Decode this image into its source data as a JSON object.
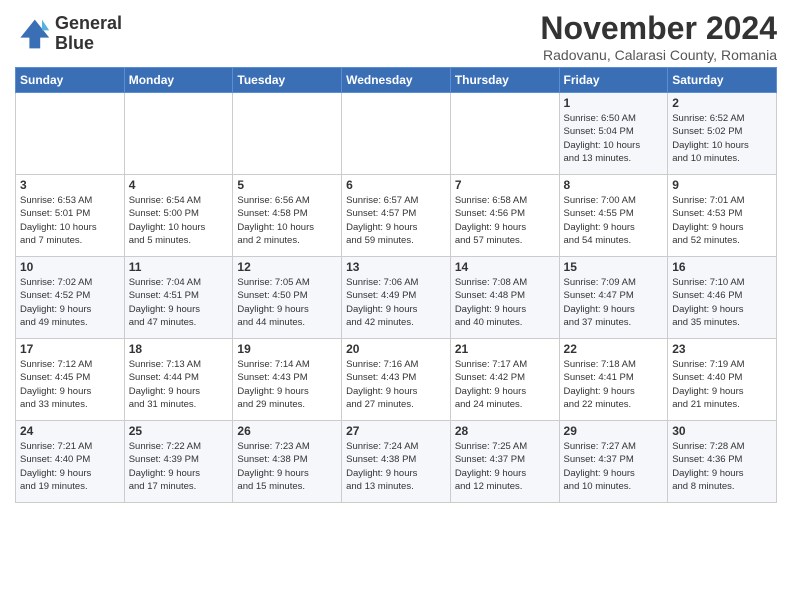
{
  "header": {
    "logo_line1": "General",
    "logo_line2": "Blue",
    "month_title": "November 2024",
    "subtitle": "Radovanu, Calarasi County, Romania"
  },
  "weekdays": [
    "Sunday",
    "Monday",
    "Tuesday",
    "Wednesday",
    "Thursday",
    "Friday",
    "Saturday"
  ],
  "weeks": [
    [
      {
        "day": "",
        "info": ""
      },
      {
        "day": "",
        "info": ""
      },
      {
        "day": "",
        "info": ""
      },
      {
        "day": "",
        "info": ""
      },
      {
        "day": "",
        "info": ""
      },
      {
        "day": "1",
        "info": "Sunrise: 6:50 AM\nSunset: 5:04 PM\nDaylight: 10 hours\nand 13 minutes."
      },
      {
        "day": "2",
        "info": "Sunrise: 6:52 AM\nSunset: 5:02 PM\nDaylight: 10 hours\nand 10 minutes."
      }
    ],
    [
      {
        "day": "3",
        "info": "Sunrise: 6:53 AM\nSunset: 5:01 PM\nDaylight: 10 hours\nand 7 minutes."
      },
      {
        "day": "4",
        "info": "Sunrise: 6:54 AM\nSunset: 5:00 PM\nDaylight: 10 hours\nand 5 minutes."
      },
      {
        "day": "5",
        "info": "Sunrise: 6:56 AM\nSunset: 4:58 PM\nDaylight: 10 hours\nand 2 minutes."
      },
      {
        "day": "6",
        "info": "Sunrise: 6:57 AM\nSunset: 4:57 PM\nDaylight: 9 hours\nand 59 minutes."
      },
      {
        "day": "7",
        "info": "Sunrise: 6:58 AM\nSunset: 4:56 PM\nDaylight: 9 hours\nand 57 minutes."
      },
      {
        "day": "8",
        "info": "Sunrise: 7:00 AM\nSunset: 4:55 PM\nDaylight: 9 hours\nand 54 minutes."
      },
      {
        "day": "9",
        "info": "Sunrise: 7:01 AM\nSunset: 4:53 PM\nDaylight: 9 hours\nand 52 minutes."
      }
    ],
    [
      {
        "day": "10",
        "info": "Sunrise: 7:02 AM\nSunset: 4:52 PM\nDaylight: 9 hours\nand 49 minutes."
      },
      {
        "day": "11",
        "info": "Sunrise: 7:04 AM\nSunset: 4:51 PM\nDaylight: 9 hours\nand 47 minutes."
      },
      {
        "day": "12",
        "info": "Sunrise: 7:05 AM\nSunset: 4:50 PM\nDaylight: 9 hours\nand 44 minutes."
      },
      {
        "day": "13",
        "info": "Sunrise: 7:06 AM\nSunset: 4:49 PM\nDaylight: 9 hours\nand 42 minutes."
      },
      {
        "day": "14",
        "info": "Sunrise: 7:08 AM\nSunset: 4:48 PM\nDaylight: 9 hours\nand 40 minutes."
      },
      {
        "day": "15",
        "info": "Sunrise: 7:09 AM\nSunset: 4:47 PM\nDaylight: 9 hours\nand 37 minutes."
      },
      {
        "day": "16",
        "info": "Sunrise: 7:10 AM\nSunset: 4:46 PM\nDaylight: 9 hours\nand 35 minutes."
      }
    ],
    [
      {
        "day": "17",
        "info": "Sunrise: 7:12 AM\nSunset: 4:45 PM\nDaylight: 9 hours\nand 33 minutes."
      },
      {
        "day": "18",
        "info": "Sunrise: 7:13 AM\nSunset: 4:44 PM\nDaylight: 9 hours\nand 31 minutes."
      },
      {
        "day": "19",
        "info": "Sunrise: 7:14 AM\nSunset: 4:43 PM\nDaylight: 9 hours\nand 29 minutes."
      },
      {
        "day": "20",
        "info": "Sunrise: 7:16 AM\nSunset: 4:43 PM\nDaylight: 9 hours\nand 27 minutes."
      },
      {
        "day": "21",
        "info": "Sunrise: 7:17 AM\nSunset: 4:42 PM\nDaylight: 9 hours\nand 24 minutes."
      },
      {
        "day": "22",
        "info": "Sunrise: 7:18 AM\nSunset: 4:41 PM\nDaylight: 9 hours\nand 22 minutes."
      },
      {
        "day": "23",
        "info": "Sunrise: 7:19 AM\nSunset: 4:40 PM\nDaylight: 9 hours\nand 21 minutes."
      }
    ],
    [
      {
        "day": "24",
        "info": "Sunrise: 7:21 AM\nSunset: 4:40 PM\nDaylight: 9 hours\nand 19 minutes."
      },
      {
        "day": "25",
        "info": "Sunrise: 7:22 AM\nSunset: 4:39 PM\nDaylight: 9 hours\nand 17 minutes."
      },
      {
        "day": "26",
        "info": "Sunrise: 7:23 AM\nSunset: 4:38 PM\nDaylight: 9 hours\nand 15 minutes."
      },
      {
        "day": "27",
        "info": "Sunrise: 7:24 AM\nSunset: 4:38 PM\nDaylight: 9 hours\nand 13 minutes."
      },
      {
        "day": "28",
        "info": "Sunrise: 7:25 AM\nSunset: 4:37 PM\nDaylight: 9 hours\nand 12 minutes."
      },
      {
        "day": "29",
        "info": "Sunrise: 7:27 AM\nSunset: 4:37 PM\nDaylight: 9 hours\nand 10 minutes."
      },
      {
        "day": "30",
        "info": "Sunrise: 7:28 AM\nSunset: 4:36 PM\nDaylight: 9 hours\nand 8 minutes."
      }
    ]
  ]
}
